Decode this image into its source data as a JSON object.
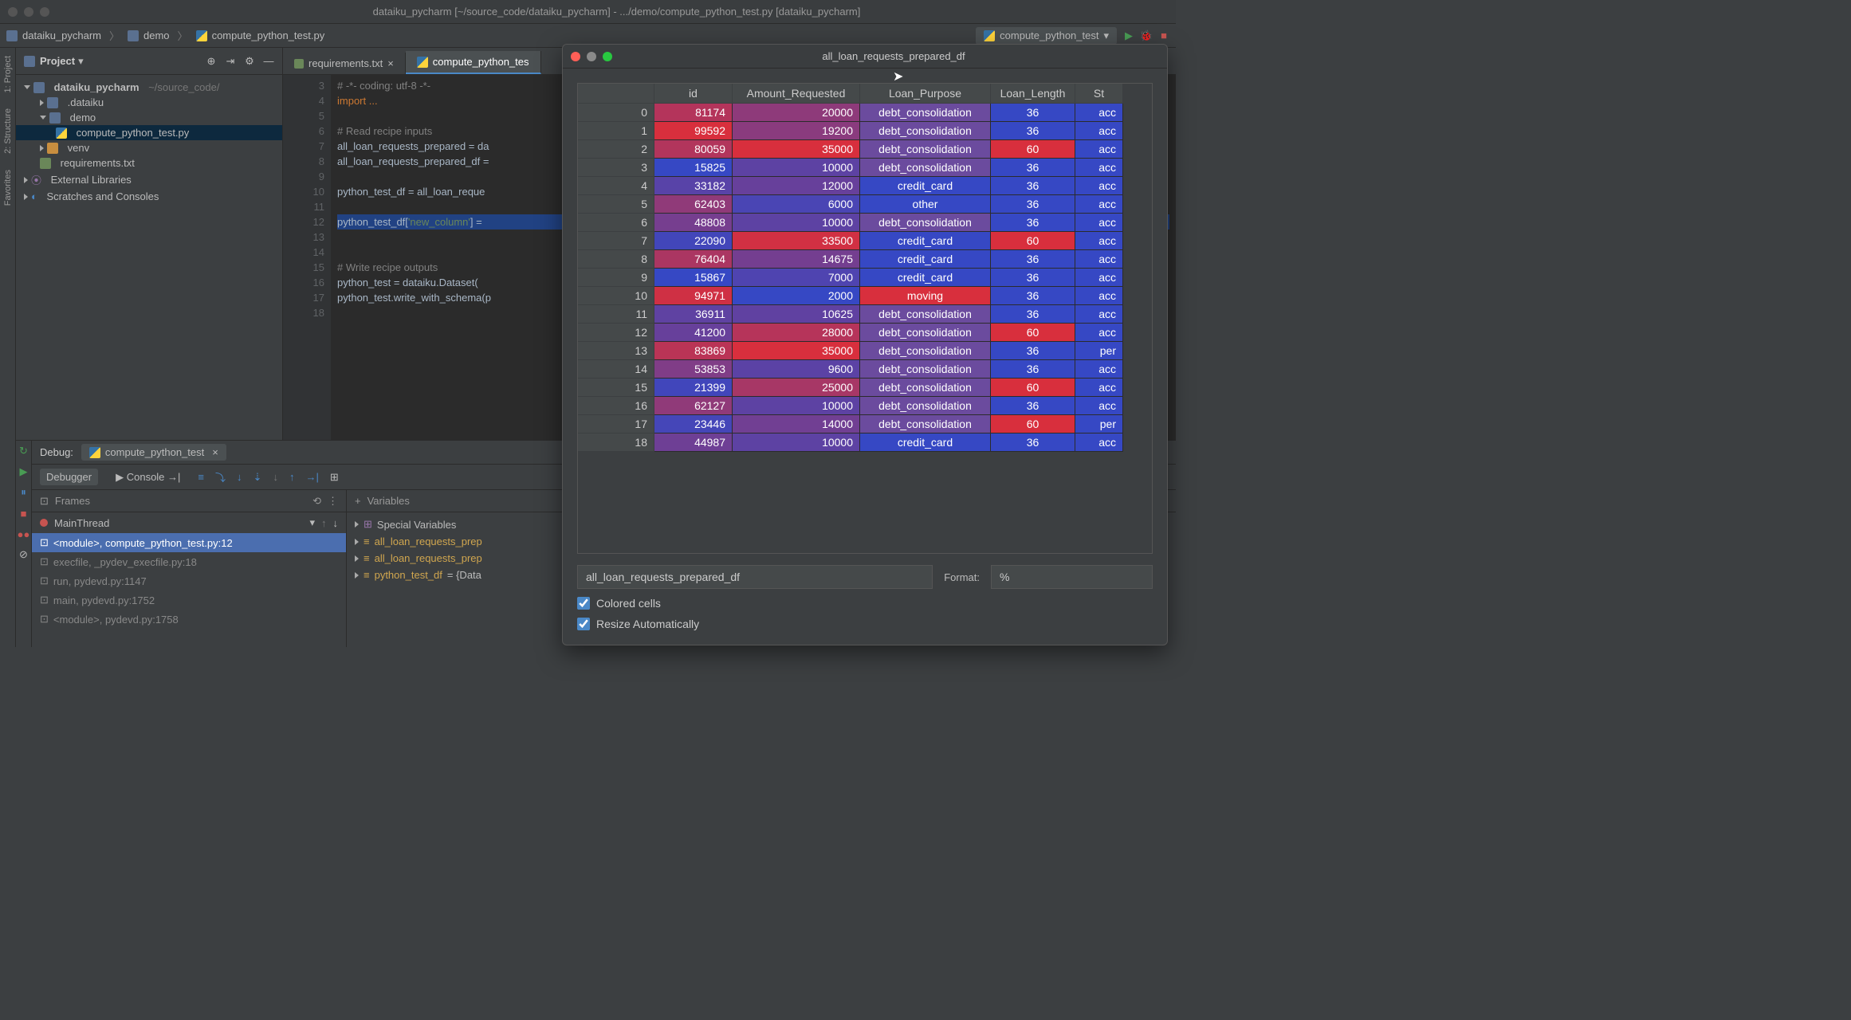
{
  "window": {
    "title": "dataiku_pycharm [~/source_code/dataiku_pycharm] - .../demo/compute_python_test.py [dataiku_pycharm]"
  },
  "breadcrumbs": [
    "dataiku_pycharm",
    "demo",
    "compute_python_test.py"
  ],
  "run_config": "compute_python_test",
  "side_tabs": [
    "1: Project",
    "2: Structure",
    "Favorites"
  ],
  "project": {
    "title": "Project",
    "tree": {
      "root": "dataiku_pycharm",
      "root_path": "~/source_code/",
      "dataiku": ".dataiku",
      "demo": "demo",
      "compute": "compute_python_test.py",
      "venv": "venv",
      "reqs": "requirements.txt",
      "ext": "External Libraries",
      "scratch": "Scratches and Consoles"
    }
  },
  "tabs": {
    "requirements": "requirements.txt",
    "compute": "compute_python_tes"
  },
  "code": {
    "l3": "# -*- coding: utf-8 -*-",
    "l4": "import ...",
    "l6": "# Read recipe inputs",
    "l7": "all_loan_requests_prepared = da",
    "l8": "all_loan_requests_prepared_df =",
    "l10": "python_test_df = all_loan_reque",
    "l12a": "python_test_df[",
    "l12b": "'new_column'",
    "l12c": "] =",
    "l15": "# Write recipe outputs",
    "l16": "python_test = dataiku.Dataset(",
    "l17": "python_test.write_with_schema(p"
  },
  "debug": {
    "label": "Debug:",
    "tab": "compute_python_test",
    "debugger": "Debugger",
    "console": "Console",
    "frames_title": "Frames",
    "vars_title": "Variables",
    "thread": "MainThread",
    "frames": [
      "<module>, compute_python_test.py:12",
      "execfile, _pydev_execfile.py:18",
      "run, pydevd.py:1147",
      "main, pydevd.py:1752",
      "<module>, pydevd.py:1758"
    ],
    "vars": {
      "special": "Special Variables",
      "v1": "all_loan_requests_prep",
      "v2": "all_loan_requests_prep",
      "v3_name": "python_test_df",
      "v3_val": " = {Data"
    }
  },
  "data_window": {
    "title": "all_loan_requests_prepared_df",
    "columns": [
      "",
      "id",
      "Amount_Requested",
      "Loan_Purpose",
      "Loan_Length",
      "St"
    ],
    "truncated_value": "acc",
    "per_row": "per",
    "input_value": "all_loan_requests_prepared_df",
    "format_label": "Format:",
    "format_value": "%",
    "check1": "Colored cells",
    "check2": "Resize Automatically"
  },
  "chart_data": {
    "type": "table",
    "columns": [
      "id",
      "Amount_Requested",
      "Loan_Purpose",
      "Loan_Length"
    ],
    "rows": [
      {
        "idx": 0,
        "id": 81174,
        "Amount_Requested": 20000,
        "Loan_Purpose": "debt_consolidation",
        "Loan_Length": 36,
        "Status": "acc"
      },
      {
        "idx": 1,
        "id": 99592,
        "Amount_Requested": 19200,
        "Loan_Purpose": "debt_consolidation",
        "Loan_Length": 36,
        "Status": "acc"
      },
      {
        "idx": 2,
        "id": 80059,
        "Amount_Requested": 35000,
        "Loan_Purpose": "debt_consolidation",
        "Loan_Length": 60,
        "Status": "acc"
      },
      {
        "idx": 3,
        "id": 15825,
        "Amount_Requested": 10000,
        "Loan_Purpose": "debt_consolidation",
        "Loan_Length": 36,
        "Status": "acc"
      },
      {
        "idx": 4,
        "id": 33182,
        "Amount_Requested": 12000,
        "Loan_Purpose": "credit_card",
        "Loan_Length": 36,
        "Status": "acc"
      },
      {
        "idx": 5,
        "id": 62403,
        "Amount_Requested": 6000,
        "Loan_Purpose": "other",
        "Loan_Length": 36,
        "Status": "acc"
      },
      {
        "idx": 6,
        "id": 48808,
        "Amount_Requested": 10000,
        "Loan_Purpose": "debt_consolidation",
        "Loan_Length": 36,
        "Status": "acc"
      },
      {
        "idx": 7,
        "id": 22090,
        "Amount_Requested": 33500,
        "Loan_Purpose": "credit_card",
        "Loan_Length": 60,
        "Status": "acc"
      },
      {
        "idx": 8,
        "id": 76404,
        "Amount_Requested": 14675,
        "Loan_Purpose": "credit_card",
        "Loan_Length": 36,
        "Status": "acc"
      },
      {
        "idx": 9,
        "id": 15867,
        "Amount_Requested": 7000,
        "Loan_Purpose": "credit_card",
        "Loan_Length": 36,
        "Status": "acc"
      },
      {
        "idx": 10,
        "id": 94971,
        "Amount_Requested": 2000,
        "Loan_Purpose": "moving",
        "Loan_Length": 36,
        "Status": "acc"
      },
      {
        "idx": 11,
        "id": 36911,
        "Amount_Requested": 10625,
        "Loan_Purpose": "debt_consolidation",
        "Loan_Length": 36,
        "Status": "acc"
      },
      {
        "idx": 12,
        "id": 41200,
        "Amount_Requested": 28000,
        "Loan_Purpose": "debt_consolidation",
        "Loan_Length": 60,
        "Status": "acc"
      },
      {
        "idx": 13,
        "id": 83869,
        "Amount_Requested": 35000,
        "Loan_Purpose": "debt_consolidation",
        "Loan_Length": 36,
        "Status": "per"
      },
      {
        "idx": 14,
        "id": 53853,
        "Amount_Requested": 9600,
        "Loan_Purpose": "debt_consolidation",
        "Loan_Length": 36,
        "Status": "acc"
      },
      {
        "idx": 15,
        "id": 21399,
        "Amount_Requested": 25000,
        "Loan_Purpose": "debt_consolidation",
        "Loan_Length": 60,
        "Status": "acc"
      },
      {
        "idx": 16,
        "id": 62127,
        "Amount_Requested": 10000,
        "Loan_Purpose": "debt_consolidation",
        "Loan_Length": 36,
        "Status": "acc"
      },
      {
        "idx": 17,
        "id": 23446,
        "Amount_Requested": 14000,
        "Loan_Purpose": "debt_consolidation",
        "Loan_Length": 60,
        "Status": "per"
      },
      {
        "idx": 18,
        "id": 44987,
        "Amount_Requested": 10000,
        "Loan_Purpose": "credit_card",
        "Loan_Length": 36,
        "Status": "acc"
      }
    ]
  }
}
